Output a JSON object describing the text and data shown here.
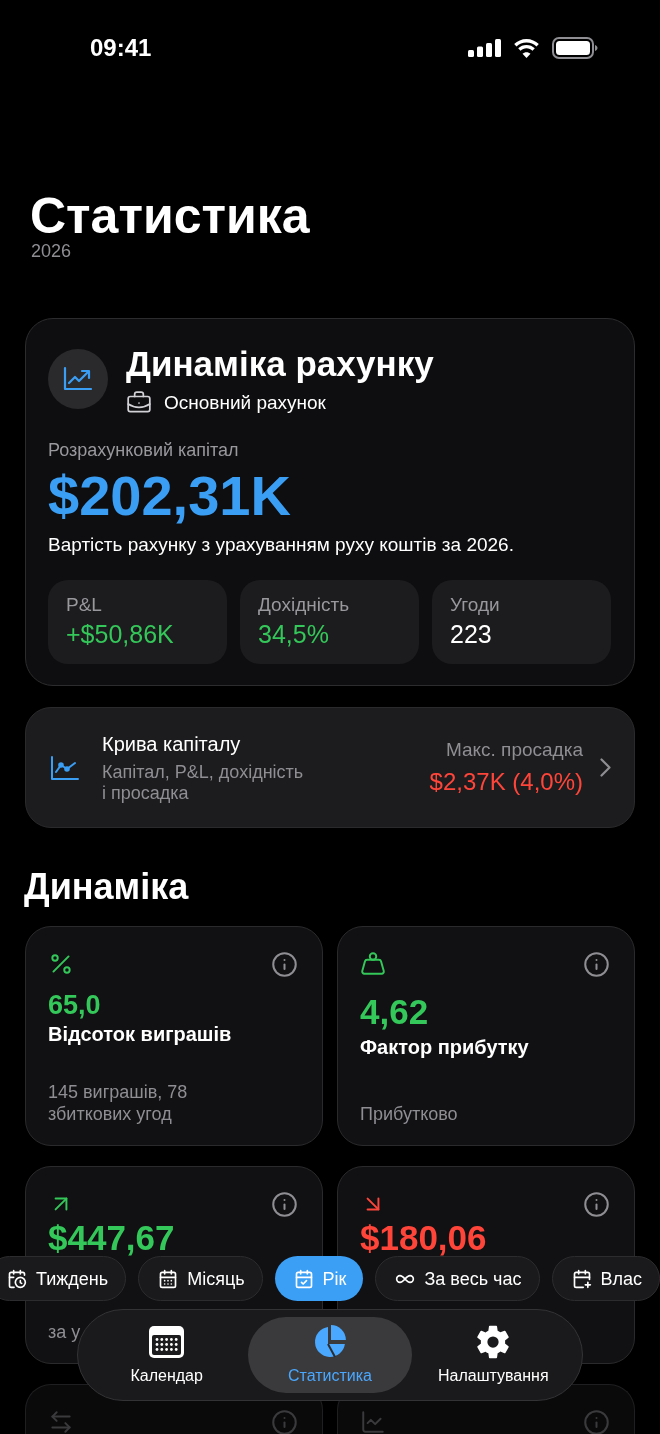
{
  "status_bar": {
    "time": "09:41"
  },
  "header": {
    "title": "Статистика",
    "subtitle": "2026"
  },
  "account_card": {
    "title": "Динаміка рахунку",
    "account": "Основний рахунок",
    "capital_label": "Розрахунковий капітал",
    "capital_value": "$202,31K",
    "description": "Вартість рахунку з урахуванням руху коштів за 2026.",
    "stats": [
      {
        "label": "P&L",
        "value": "+$50,86K",
        "color": "#34c759"
      },
      {
        "label": "Дохідність",
        "value": "34,5%",
        "color": "#34c759"
      },
      {
        "label": "Угоди",
        "value": "223",
        "color": "#ffffff"
      }
    ]
  },
  "equity_curve": {
    "title": "Крива капіталу",
    "subtitle": "Капітал, P&L, дохідність і просадка",
    "drawdown_label": "Макс. просадка",
    "drawdown_value": "$2,37K (4,0%)"
  },
  "section_title": "Динаміка",
  "metrics": [
    {
      "kind": "win_rate",
      "color": "#34c759",
      "value": "65,0",
      "label": "Відсоток виграшів",
      "note": "145 виграшів, 78 збиткових угод"
    },
    {
      "kind": "profit_factor",
      "color": "#34c759",
      "value": "4,62",
      "label": "Фактор прибутку",
      "note": "Прибутково"
    },
    {
      "kind": "average_win",
      "color": "#34c759",
      "value": "$447,67",
      "note": "за у"
    },
    {
      "kind": "average_loss",
      "color": "#ff453a",
      "value": "$180,06"
    },
    {
      "kind": "trade_flow"
    },
    {
      "kind": "trend"
    }
  ],
  "period_filter": [
    {
      "kind": "week",
      "label": "Тиждень",
      "selected": false
    },
    {
      "kind": "month",
      "label": "Місяць",
      "selected": false
    },
    {
      "kind": "year",
      "label": "Рік",
      "selected": true
    },
    {
      "kind": "all_time",
      "label": "За весь час",
      "selected": false
    },
    {
      "kind": "custom",
      "label": "Влас",
      "selected": false
    }
  ],
  "tab_bar": [
    {
      "kind": "calendar",
      "label": "Календар",
      "selected": false
    },
    {
      "kind": "statistics",
      "label": "Статистика",
      "selected": true
    },
    {
      "kind": "settings",
      "label": "Налаштування",
      "selected": false
    }
  ]
}
